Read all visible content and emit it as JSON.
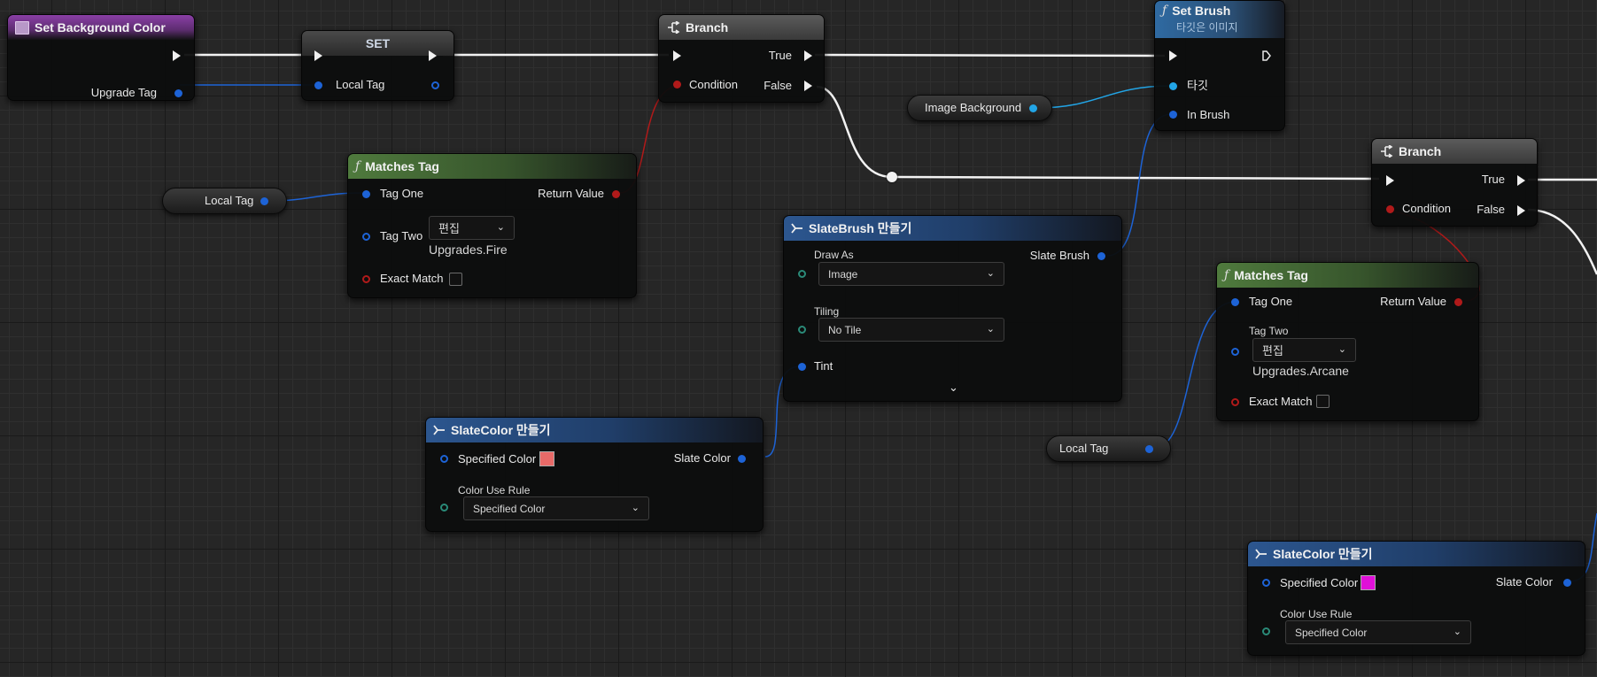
{
  "nodes": {
    "set_background_color": {
      "title": "Set Background Color",
      "upgrade_tag": "Upgrade Tag"
    },
    "set_var": {
      "title": "SET",
      "local_tag": "Local Tag"
    },
    "branch1": {
      "title": "Branch",
      "true": "True",
      "false": "False",
      "condition": "Condition"
    },
    "set_brush": {
      "title": "Set Brush",
      "subtitle": "타깃은 이미지",
      "target": "타깃",
      "in_brush": "In Brush"
    },
    "image_background": {
      "label": "Image Background"
    },
    "local_tag_var1": {
      "label": "Local Tag"
    },
    "matches_tag1": {
      "title": "Matches Tag",
      "tag_one": "Tag One",
      "tag_two": "Tag Two",
      "edit": "편집",
      "tag_value": "Upgrades.Fire",
      "exact_match": "Exact Match",
      "return_value": "Return Value"
    },
    "slatebrush": {
      "title": "SlateBrush 만들기",
      "draw_as": "Draw As",
      "draw_as_value": "Image",
      "tiling": "Tiling",
      "tiling_value": "No Tile",
      "tint": "Tint",
      "slate_brush": "Slate Brush"
    },
    "slatecolor1": {
      "title": "SlateColor 만들기",
      "specified_color": "Specified Color",
      "color_value": "#e86a68",
      "color_use_rule": "Color Use Rule",
      "rule_value": "Specified Color",
      "slate_color": "Slate Color"
    },
    "branch2": {
      "title": "Branch",
      "true": "True",
      "false": "False",
      "condition": "Condition"
    },
    "matches_tag2": {
      "title": "Matches Tag",
      "tag_one": "Tag One",
      "tag_two": "Tag Two",
      "edit": "편집",
      "tag_value": "Upgrades.Arcane",
      "exact_match": "Exact Match",
      "return_value": "Return Value"
    },
    "local_tag_var2": {
      "label": "Local Tag"
    },
    "slatecolor2": {
      "title": "SlateColor 만들기",
      "specified_color": "Specified Color",
      "color_value": "#e010d8",
      "color_use_rule": "Color Use Rule",
      "rule_value": "Specified Color",
      "slate_color": "Slate Color"
    }
  },
  "icons": {
    "function": "function-icon",
    "branch": "branch-icon",
    "make_struct": "make-struct-icon",
    "event": "event-icon"
  },
  "colors": {
    "exec": "#f0f0f0",
    "object": "#1d63d6",
    "bool": "#b01a1a",
    "image_ref": "#22a5e6",
    "struct": "#2a8a78"
  }
}
